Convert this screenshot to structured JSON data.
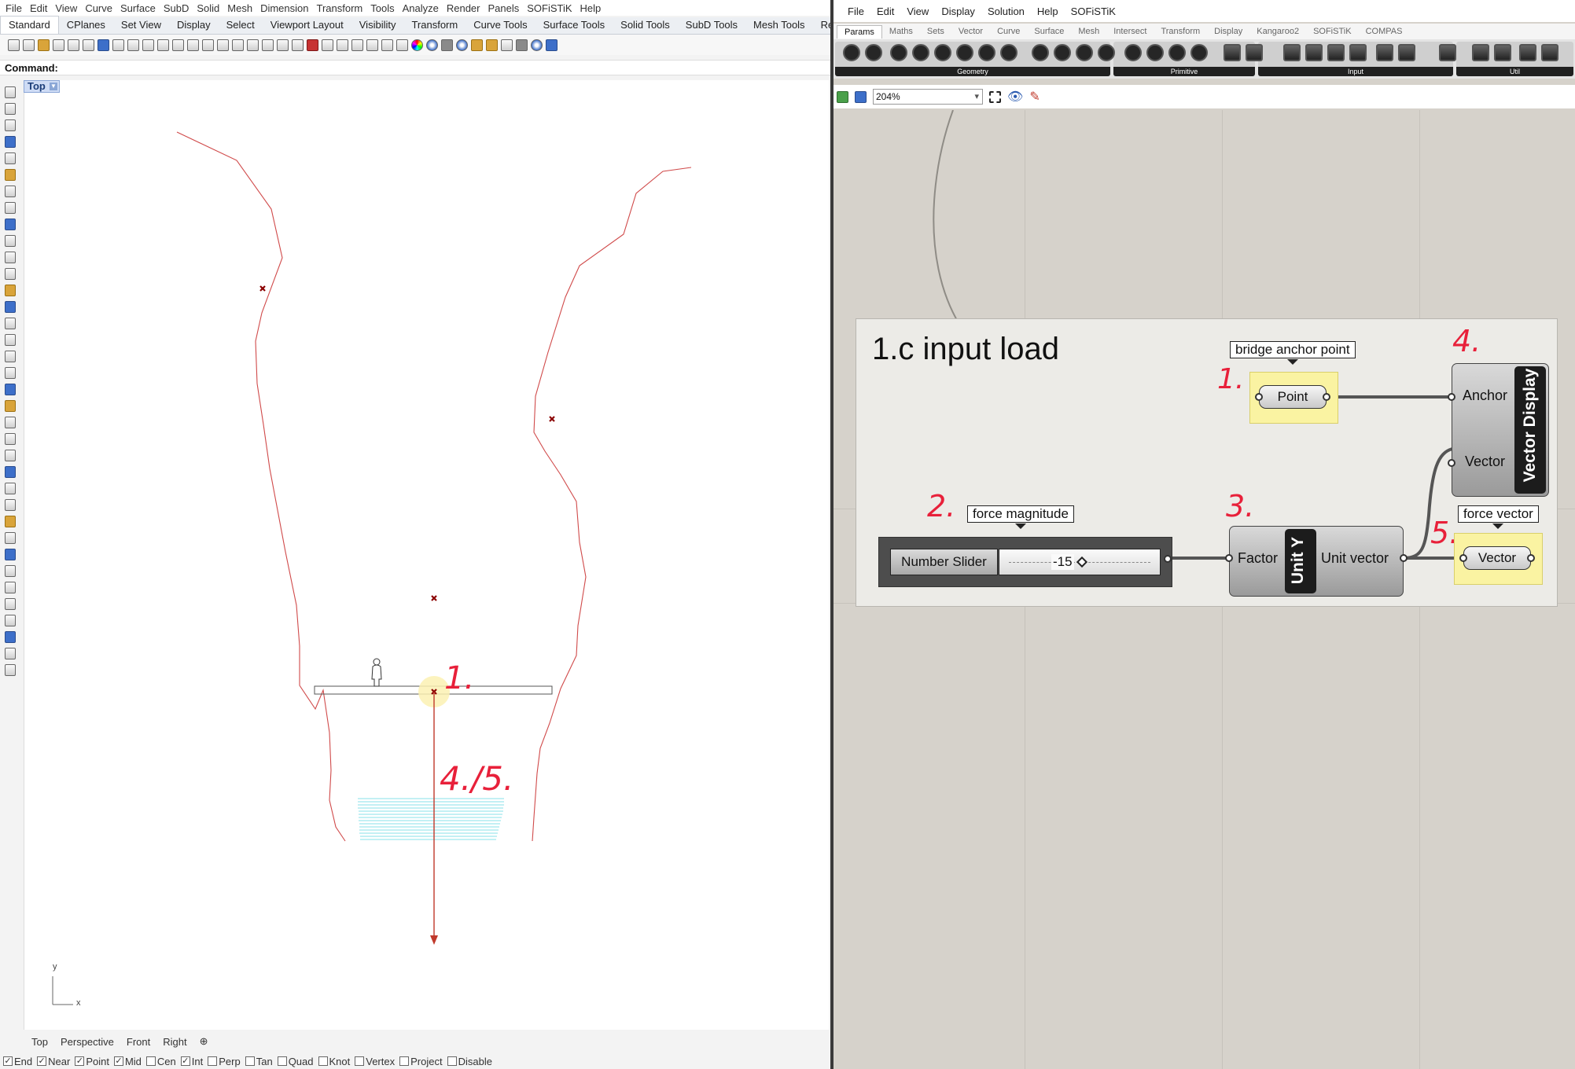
{
  "rhino": {
    "menu": [
      "File",
      "Edit",
      "View",
      "Curve",
      "Surface",
      "SubD",
      "Solid",
      "Mesh",
      "Dimension",
      "Transform",
      "Tools",
      "Analyze",
      "Render",
      "Panels",
      "SOFiSTiK",
      "Help"
    ],
    "tabs": [
      "Standard",
      "CPlanes",
      "Set View",
      "Display",
      "Select",
      "Viewport Layout",
      "Visibility",
      "Transform",
      "Curve Tools",
      "Surface Tools",
      "Solid Tools",
      "SubD Tools",
      "Mesh Tools",
      "Rend"
    ],
    "command_label": "Command:",
    "viewport_title": "Top",
    "viewport_tabs": [
      "Top",
      "Perspective",
      "Front",
      "Right"
    ],
    "axis_x": "x",
    "axis_y": "y",
    "osnaps": [
      {
        "label": "End",
        "checked": true
      },
      {
        "label": "Near",
        "checked": true
      },
      {
        "label": "Point",
        "checked": true
      },
      {
        "label": "Mid",
        "checked": true
      },
      {
        "label": "Cen",
        "checked": false
      },
      {
        "label": "Int",
        "checked": true
      },
      {
        "label": "Perp",
        "checked": false
      },
      {
        "label": "Tan",
        "checked": false
      },
      {
        "label": "Quad",
        "checked": false
      },
      {
        "label": "Knot",
        "checked": false
      },
      {
        "label": "Vertex",
        "checked": false
      },
      {
        "label": "Project",
        "checked": false
      },
      {
        "label": "Disable",
        "checked": false
      }
    ],
    "annotations": {
      "one": "1.",
      "four_five": "4./5."
    },
    "colors": {
      "curve": "#c0392b",
      "water": "#37c3cf",
      "point": "#8b0000"
    }
  },
  "gh": {
    "menu": [
      "File",
      "Edit",
      "View",
      "Display",
      "Solution",
      "Help",
      "SOFiSTiK"
    ],
    "tabs": [
      "Params",
      "Maths",
      "Sets",
      "Vector",
      "Curve",
      "Surface",
      "Mesh",
      "Intersect",
      "Transform",
      "Display",
      "Kangaroo2",
      "SOFiSTiK",
      "COMPAS"
    ],
    "ribbon_groups": [
      "Geometry",
      "Primitive",
      "Input",
      "Util"
    ],
    "zoom": "204%",
    "group_title": "1.c input load",
    "bubbles": {
      "anchor": "bridge anchor point",
      "force": "force magnitude",
      "vector": "force vector"
    },
    "point_label": "Point",
    "vector_display": {
      "title": "Vector Display",
      "in1": "Anchor",
      "in2": "Vector"
    },
    "slider": {
      "name": "Number Slider",
      "value": "-15"
    },
    "unit_y": {
      "title": "Unit Y",
      "in": "Factor",
      "out": "Unit vector"
    },
    "vector_param": "Vector",
    "steps": {
      "s1": "1.",
      "s2": "2.",
      "s3": "3.",
      "s4": "4.",
      "s5": "5."
    }
  }
}
